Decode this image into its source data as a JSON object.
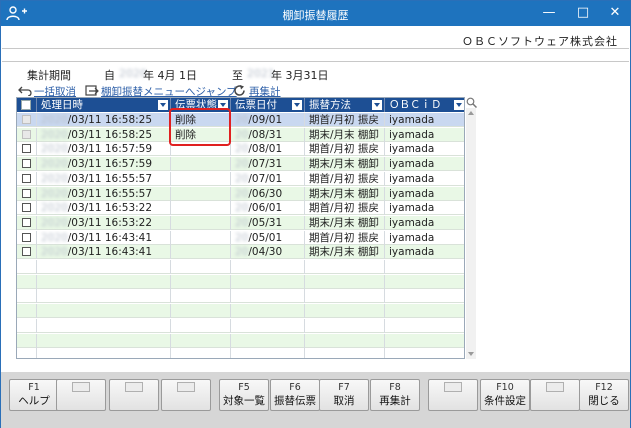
{
  "window": {
    "title": "棚卸振替履歴",
    "controls": [
      "minimize-icon",
      "maximize-icon",
      "close-icon"
    ]
  },
  "company_name": "ＯＢＣソフトウェア株式会社",
  "period": {
    "label": "集計期間",
    "from_prefix": "自",
    "from_year": "2020",
    "from_rest": "年  4月 1日",
    "to_prefix": "至",
    "to_year": "2021",
    "to_rest": "年  3月31日"
  },
  "toolbar": {
    "bulk_cancel": "一括取消",
    "jump": "棚卸振替メニューへジャンプ",
    "recalc": "再集計"
  },
  "table": {
    "columns": [
      "処理日時",
      "伝票状態",
      "伝票日付",
      "振替方法",
      "ＯＢＣｉＤ"
    ],
    "rows": [
      {
        "date_year": "2020",
        "date_rest": "/03/11 16:58:25",
        "status": "削除",
        "vdate_year": "20",
        "vdate_rest": "/09/01",
        "method": "期首/月初 振戻",
        "obcid": "iyamada",
        "checkable": false,
        "selected": true
      },
      {
        "date_year": "2020",
        "date_rest": "/03/11 16:58:25",
        "status": "削除",
        "vdate_year": "20",
        "vdate_rest": "/08/31",
        "method": "期末/月末 棚卸",
        "obcid": "iyamada",
        "checkable": false,
        "selected": false
      },
      {
        "date_year": "2020",
        "date_rest": "/03/11 16:57:59",
        "status": "",
        "vdate_year": "20",
        "vdate_rest": "/08/01",
        "method": "期首/月初 振戻",
        "obcid": "iyamada",
        "checkable": true,
        "selected": false
      },
      {
        "date_year": "2020",
        "date_rest": "/03/11 16:57:59",
        "status": "",
        "vdate_year": "20",
        "vdate_rest": "/07/31",
        "method": "期末/月末 棚卸",
        "obcid": "iyamada",
        "checkable": true,
        "selected": false
      },
      {
        "date_year": "2020",
        "date_rest": "/03/11 16:55:57",
        "status": "",
        "vdate_year": "20",
        "vdate_rest": "/07/01",
        "method": "期首/月初 振戻",
        "obcid": "iyamada",
        "checkable": true,
        "selected": false
      },
      {
        "date_year": "2020",
        "date_rest": "/03/11 16:55:57",
        "status": "",
        "vdate_year": "20",
        "vdate_rest": "/06/30",
        "method": "期末/月末 棚卸",
        "obcid": "iyamada",
        "checkable": true,
        "selected": false
      },
      {
        "date_year": "2020",
        "date_rest": "/03/11 16:53:22",
        "status": "",
        "vdate_year": "20",
        "vdate_rest": "/06/01",
        "method": "期首/月初 振戻",
        "obcid": "iyamada",
        "checkable": true,
        "selected": false
      },
      {
        "date_year": "2020",
        "date_rest": "/03/11 16:53:22",
        "status": "",
        "vdate_year": "20",
        "vdate_rest": "/05/31",
        "method": "期末/月末 棚卸",
        "obcid": "iyamada",
        "checkable": true,
        "selected": false
      },
      {
        "date_year": "2020",
        "date_rest": "/03/11 16:43:41",
        "status": "",
        "vdate_year": "20",
        "vdate_rest": "/05/01",
        "method": "期首/月初 振戻",
        "obcid": "iyamada",
        "checkable": true,
        "selected": false
      },
      {
        "date_year": "2020",
        "date_rest": "/03/11 16:43:41",
        "status": "",
        "vdate_year": "20",
        "vdate_rest": "/04/30",
        "method": "期末/月末 棚卸",
        "obcid": "iyamada",
        "checkable": true,
        "selected": false
      }
    ],
    "empty_rows": 7
  },
  "function_keys": [
    {
      "key": "F1",
      "label": "ヘルプ"
    },
    {
      "key": "",
      "label": ""
    },
    {
      "key": "",
      "label": ""
    },
    {
      "key": "",
      "label": ""
    },
    {
      "key": "F5",
      "label": "対象一覧"
    },
    {
      "key": "F6",
      "label": "振替伝票"
    },
    {
      "key": "F7",
      "label": "取消"
    },
    {
      "key": "F8",
      "label": "再集計"
    },
    {
      "key": "",
      "label": ""
    },
    {
      "key": "F10",
      "label": "条件設定"
    },
    {
      "key": "",
      "label": ""
    },
    {
      "key": "F12",
      "label": "閉じる"
    }
  ],
  "colors": {
    "titlebar": "#1e73be",
    "header": "#1d4f94",
    "row_alt": "#e9f8e6",
    "row_selected": "#c9d8f0",
    "highlight": "#e02020"
  }
}
